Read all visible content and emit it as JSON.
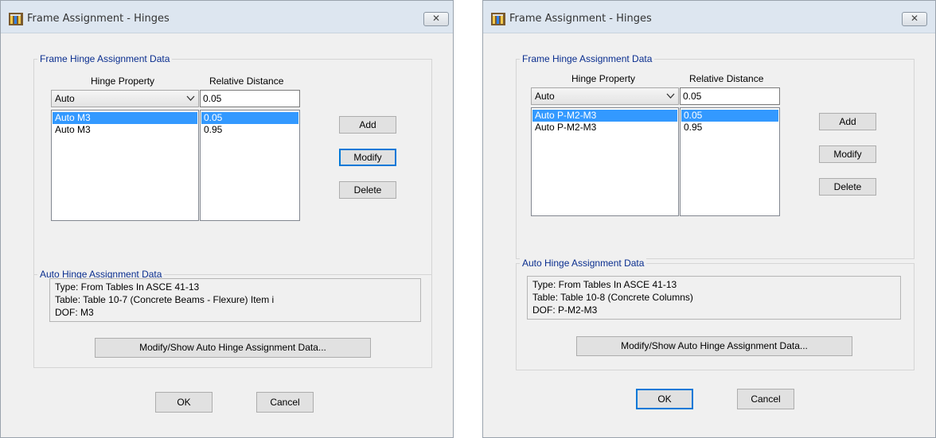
{
  "dialogs": [
    {
      "title": "Frame Assignment - Hinges",
      "close_glyph": "✕",
      "frame_group": {
        "legend": "Frame Hinge Assignment Data",
        "hinge_property_header": "Hinge Property",
        "relative_distance_header": "Relative Distance",
        "hinge_property_selected": "Auto",
        "relative_distance_value": "0.05",
        "hinge_list": [
          "Auto  M3",
          "Auto  M3"
        ],
        "distance_list": [
          "0.05",
          "0.95"
        ],
        "add_label": "Add",
        "modify_label": "Modify",
        "delete_label": "Delete"
      },
      "auto_group": {
        "legend": "Auto Hinge Assignment Data",
        "type_line": "Type:  From Tables In ASCE 41-13",
        "table_line": "Table:  Table 10-7 (Concrete Beams - Flexure) Item i",
        "dof_line": "DOF:  M3",
        "modify_show_label": "Modify/Show Auto Hinge Assignment Data..."
      },
      "ok_label": "OK",
      "cancel_label": "Cancel"
    },
    {
      "title": "Frame Assignment - Hinges",
      "close_glyph": "✕",
      "frame_group": {
        "legend": "Frame Hinge Assignment Data",
        "hinge_property_header": "Hinge Property",
        "relative_distance_header": "Relative Distance",
        "hinge_property_selected": "Auto",
        "relative_distance_value": "0.05",
        "hinge_list": [
          "Auto  P-M2-M3",
          "Auto  P-M2-M3"
        ],
        "distance_list": [
          "0.05",
          "0.95"
        ],
        "add_label": "Add",
        "modify_label": "Modify",
        "delete_label": "Delete"
      },
      "auto_group": {
        "legend": "Auto Hinge Assignment Data",
        "type_line": "Type:  From Tables In ASCE 41-13",
        "table_line": "Table:  Table 10-8 (Concrete Columns)",
        "dof_line": "DOF:  P-M2-M3",
        "modify_show_label": "Modify/Show Auto Hinge Assignment Data..."
      },
      "ok_label": "OK",
      "cancel_label": "Cancel"
    }
  ]
}
